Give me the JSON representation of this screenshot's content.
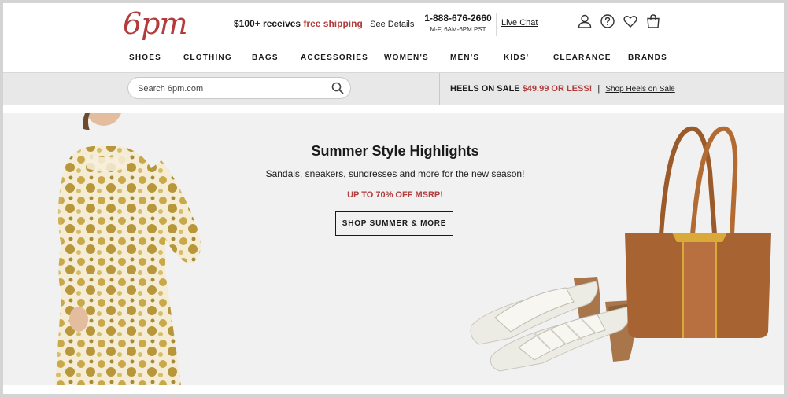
{
  "header": {
    "logo": "6pm",
    "promo_prefix": "$100+ receives",
    "promo_highlight": "free shipping",
    "promo_link": "See Details",
    "phone": "1-888-676-2660",
    "hours": "M-F, 6AM-6PM PST",
    "live_chat": "Live Chat",
    "icons": [
      "user-icon",
      "help-icon",
      "heart-icon",
      "cart-icon"
    ]
  },
  "nav": [
    "SHOES",
    "CLOTHING",
    "BAGS",
    "ACCESSORIES",
    "WOMEN'S",
    "MEN'S",
    "KIDS'",
    "CLEARANCE",
    "BRANDS"
  ],
  "search": {
    "placeholder": "Search 6pm.com"
  },
  "sale_banner": {
    "prefix": "HEELS ON SALE",
    "price": "$49.99 OR LESS!",
    "separator": "|",
    "link": "Shop Heels on Sale"
  },
  "hero": {
    "title": "Summer Style Highlights",
    "subtitle": "Sandals, sneakers, sundresses and more for the new season!",
    "offer": "UP TO 70% OFF MSRP!",
    "cta": "SHOP SUMMER & MORE"
  },
  "colors": {
    "brand": "#b23b3b",
    "band": "#e8e8e8",
    "hero_bg": "#f1f1f1"
  }
}
